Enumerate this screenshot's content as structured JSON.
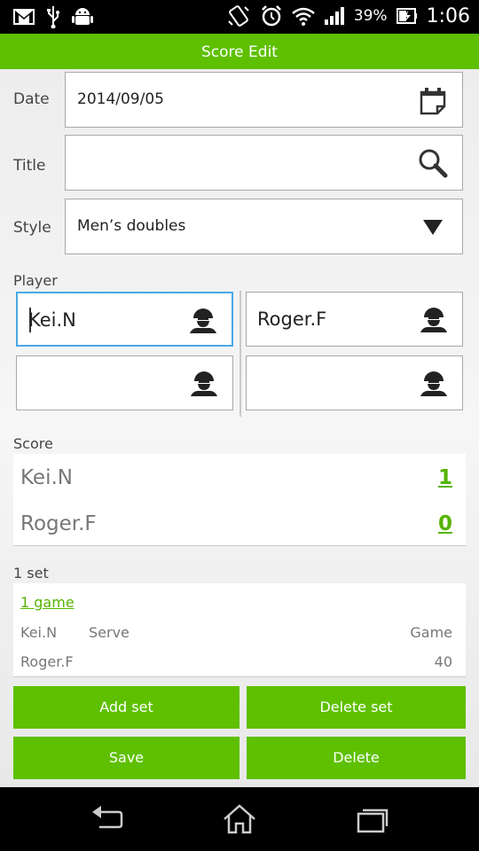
{
  "status_bar": {
    "battery_percent": "39%",
    "time": "1:06",
    "left_icons": [
      "gmail-icon",
      "usb-icon",
      "android-debug-icon"
    ],
    "right_icons": [
      "vibrate-icon",
      "alarm-icon",
      "wifi-icon",
      "signal-icon",
      "battery-charging-icon"
    ]
  },
  "header": {
    "title": "Score Edit"
  },
  "form": {
    "date": {
      "label": "Date",
      "value": "2014/09/05",
      "icon": "calendar-icon"
    },
    "title": {
      "label": "Title",
      "value": "",
      "icon": "search-icon"
    },
    "style": {
      "label": "Style",
      "value": "Men’s doubles",
      "icon": "dropdown-arrow-icon"
    }
  },
  "players": {
    "label": "Player",
    "team_a": [
      "Kei.N",
      ""
    ],
    "team_b": [
      "Roger.F",
      ""
    ],
    "icon": "person-icon"
  },
  "score": {
    "label": "Score",
    "rows": [
      {
        "name": "Kei.N",
        "value": "1"
      },
      {
        "name": "Roger.F",
        "value": "0"
      }
    ]
  },
  "set": {
    "label": "1 set",
    "game_link": "1 game",
    "rows": [
      {
        "name": "Kei.N",
        "serve": "Serve",
        "game": "Game"
      },
      {
        "name": "Roger.F",
        "serve": "",
        "game": "40"
      }
    ]
  },
  "buttons": {
    "add_set": "Add set",
    "delete_set": "Delete set",
    "save": "Save",
    "delete": "Delete"
  },
  "colors": {
    "accent": "#5ec000",
    "link": "#56b300",
    "focus": "#4aa8e8"
  }
}
